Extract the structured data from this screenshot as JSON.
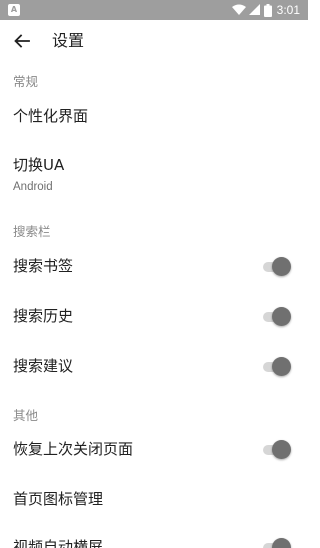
{
  "status_bar": {
    "time": "3:01",
    "left_icon": "A"
  },
  "app_bar": {
    "title": "设置"
  },
  "sections": {
    "general": "常规",
    "searchbar": "搜索栏",
    "other": "其他"
  },
  "items": {
    "personalize": "个性化界面",
    "switch_ua": {
      "label": "切换UA",
      "value": "Android"
    },
    "search_bookmarks": "搜索书签",
    "search_history": "搜索历史",
    "search_suggestions": "搜索建议",
    "restore_last_closed": "恢复上次关闭页面",
    "homepage_icon_manage": "首页图标管理",
    "video_auto_landscape": "视频自动横屏"
  },
  "toggles": {
    "search_bookmarks": true,
    "search_history": true,
    "search_suggestions": true,
    "restore_last_closed": true,
    "video_auto_landscape": true
  },
  "colors": {
    "status_bar": "#9e9e9e",
    "section_header": "#8a8a8a",
    "switch_track": "#d6d6d6",
    "switch_thumb": "#707070"
  }
}
